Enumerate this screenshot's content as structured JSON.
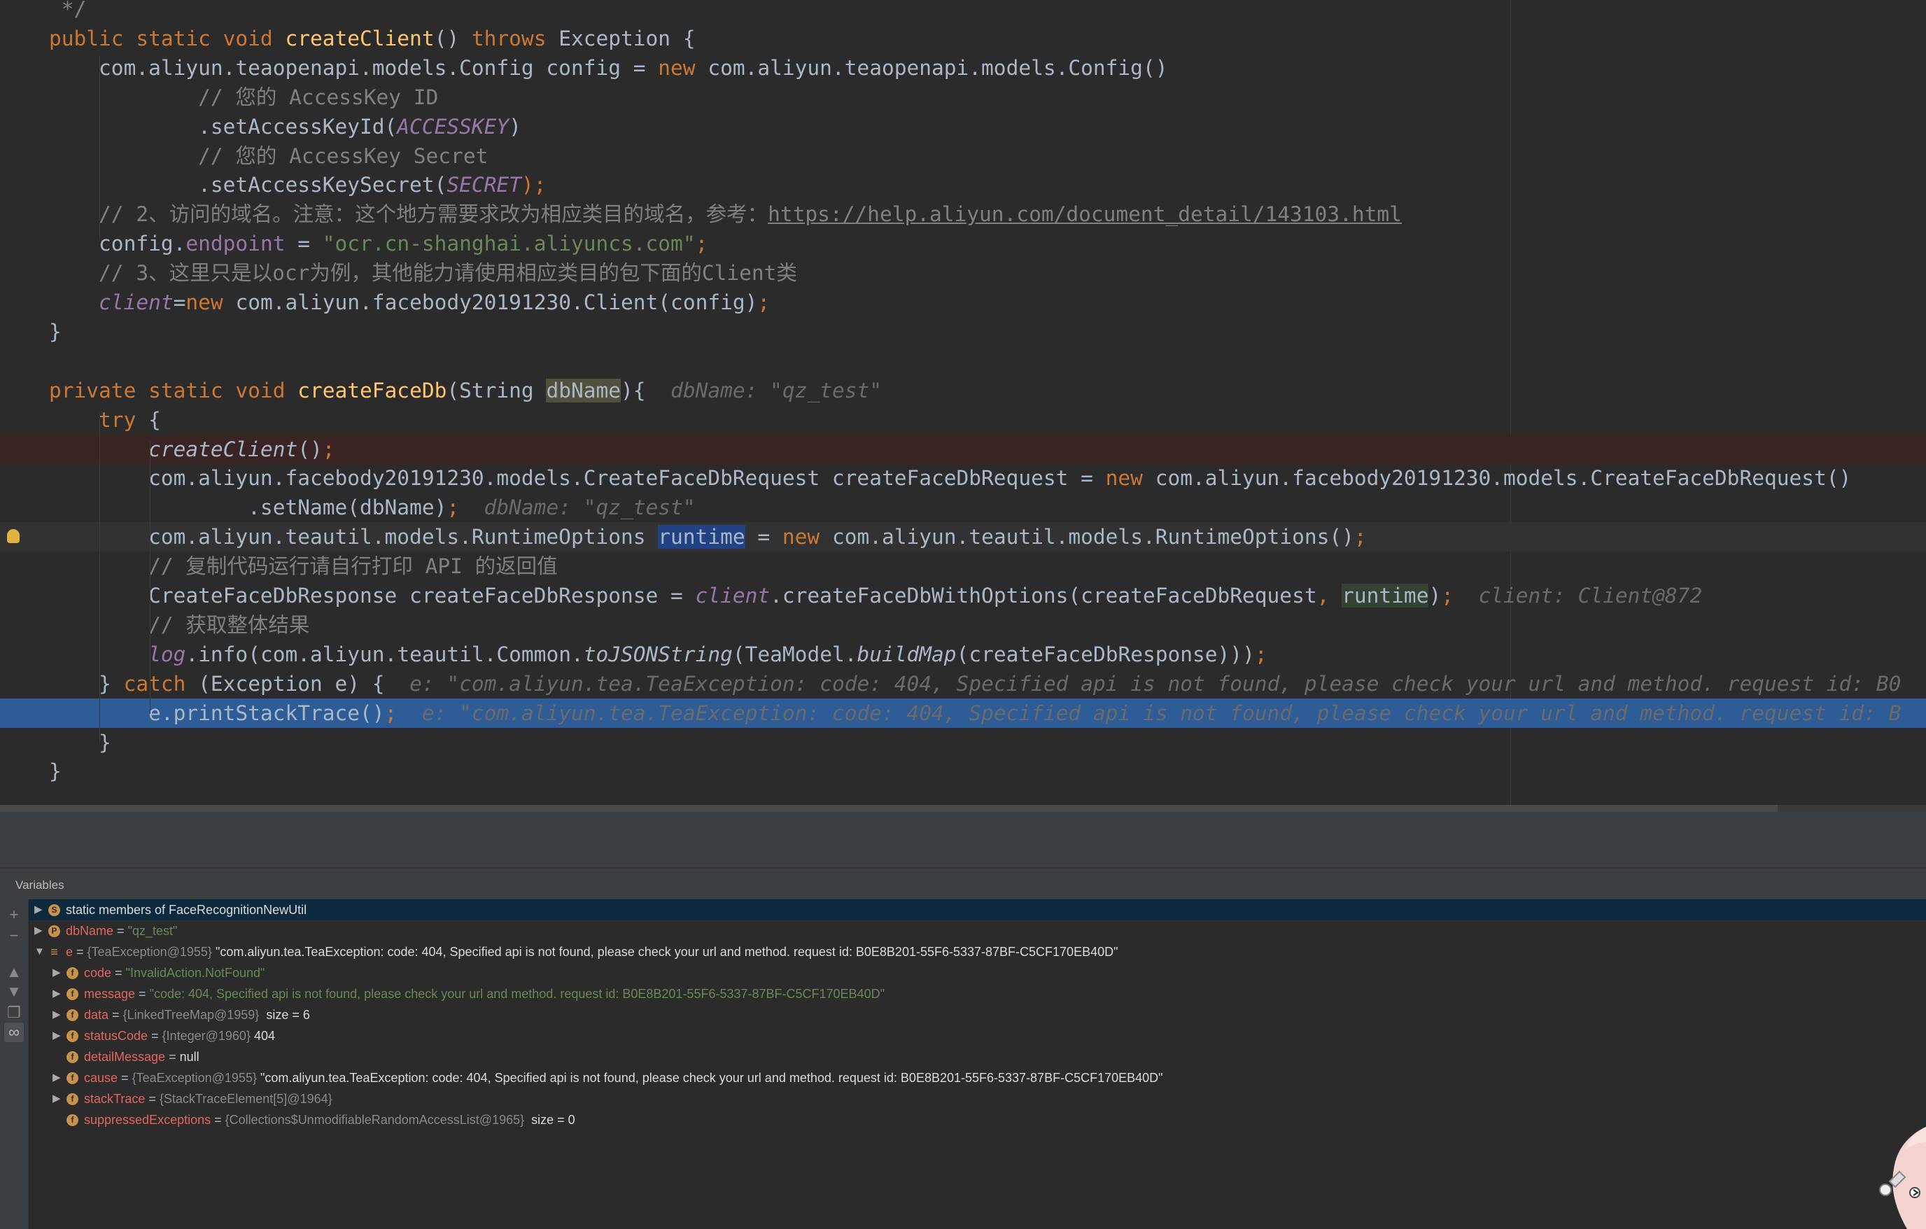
{
  "editor": {
    "lines": [
      [
        {
          "t": " */",
          "c": "cm"
        }
      ],
      [
        {
          "t": "public static void ",
          "c": "kw"
        },
        {
          "t": "createClient",
          "c": "fn"
        },
        {
          "t": "() "
        },
        {
          "t": "throws ",
          "c": "kw"
        },
        {
          "t": "Exception {"
        }
      ],
      [
        {
          "t": "    com.aliyun.teaopenapi.models.Config config = "
        },
        {
          "t": "new ",
          "c": "kw"
        },
        {
          "t": "com.aliyun.teaopenapi.models.Config()"
        }
      ],
      [
        {
          "t": "            // 您的 AccessKey ID",
          "c": "cm"
        }
      ],
      [
        {
          "t": "            .setAccessKeyId("
        },
        {
          "t": "ACCESSKEY",
          "c": "const"
        },
        {
          "t": ")"
        }
      ],
      [
        {
          "t": "            // 您的 AccessKey Secret",
          "c": "cm"
        }
      ],
      [
        {
          "t": "            .setAccessKeySecret("
        },
        {
          "t": "SECRET",
          "c": "const"
        },
        {
          "t": ");",
          "c": "kw"
        }
      ],
      [
        {
          "t": "    // 2、访问的域名。注意：这个地方需要求改为相应类目的域名，参考：",
          "c": "cm"
        },
        {
          "t": "https://help.aliyun.com/document_detail/143103.html",
          "c": "link"
        }
      ],
      [
        {
          "t": "    config."
        },
        {
          "t": "endpoint",
          "c": "fd"
        },
        {
          "t": " = "
        },
        {
          "t": "\"ocr.cn-shanghai.aliyuncs.com\"",
          "c": "st"
        },
        {
          "t": ";",
          "c": "kw"
        }
      ],
      [
        {
          "t": "    // 3、这里只是以ocr为例，其他能力请使用相应类目的包下面的Client类",
          "c": "cm"
        }
      ],
      [
        {
          "t": "    "
        },
        {
          "t": "client",
          "c": "fd it"
        },
        {
          "t": "="
        },
        {
          "t": "new ",
          "c": "kw"
        },
        {
          "t": "com.aliyun.facebody20191230.Client(config)"
        },
        {
          "t": ";",
          "c": "kw"
        }
      ],
      [
        {
          "t": "}"
        }
      ],
      [],
      [
        {
          "t": "private static void ",
          "c": "kw"
        },
        {
          "t": "createFaceDb",
          "c": "fn"
        },
        {
          "t": "(String "
        },
        {
          "t": "dbName",
          "c": "param-hl"
        },
        {
          "t": "){  "
        },
        {
          "t": "dbName: \"qz_test\"",
          "c": "hint"
        }
      ],
      [
        {
          "t": "    "
        },
        {
          "t": "try ",
          "c": "kw"
        },
        {
          "t": "{"
        }
      ],
      [
        {
          "t": "        "
        },
        {
          "t": "createClient",
          "c": "it"
        },
        {
          "t": "()"
        },
        {
          "t": ";",
          "c": "kw"
        }
      ],
      [
        {
          "t": "        com.aliyun.facebody20191230.models.CreateFaceDbRequest createFaceDbRequest = "
        },
        {
          "t": "new ",
          "c": "kw"
        },
        {
          "t": "com.aliyun.facebody20191230.models.CreateFaceDbRequest()"
        }
      ],
      [
        {
          "t": "                .setName(dbName)"
        },
        {
          "t": ";",
          "c": "kw"
        },
        {
          "t": "  "
        },
        {
          "t": "dbName: \"qz_test\"",
          "c": "hint"
        }
      ],
      [
        {
          "t": "        com.aliyun.teautil.models.RuntimeOptions "
        },
        {
          "t": "runtime",
          "c": "sel-hl"
        },
        {
          "t": " = "
        },
        {
          "t": "new ",
          "c": "kw"
        },
        {
          "t": "com.aliyun.teautil.models.RuntimeOptions()"
        },
        {
          "t": ";",
          "c": "kw"
        }
      ],
      [
        {
          "t": "        // 复制代码运行请自行打印 API 的返回值",
          "c": "cm"
        }
      ],
      [
        {
          "t": "        CreateFaceDbResponse createFaceDbResponse = "
        },
        {
          "t": "client",
          "c": "fd it"
        },
        {
          "t": ".createFaceDbWithOptions(createFaceDbRequest"
        },
        {
          "t": ", ",
          "c": "kw"
        },
        {
          "t": "runtime",
          "c": "rt-hl"
        },
        {
          "t": ")"
        },
        {
          "t": ";",
          "c": "kw"
        },
        {
          "t": "  "
        },
        {
          "t": "client: Client@872",
          "c": "hint"
        }
      ],
      [
        {
          "t": "        // 获取整体结果",
          "c": "cm"
        }
      ],
      [
        {
          "t": "        "
        },
        {
          "t": "log",
          "c": "fd it"
        },
        {
          "t": ".info(com.aliyun.teautil.Common."
        },
        {
          "t": "toJSONString",
          "c": "it"
        },
        {
          "t": "(TeaModel."
        },
        {
          "t": "buildMap",
          "c": "it"
        },
        {
          "t": "(createFaceDbResponse)))"
        },
        {
          "t": ";",
          "c": "kw"
        }
      ],
      [
        {
          "t": "    } "
        },
        {
          "t": "catch ",
          "c": "kw"
        },
        {
          "t": "(Exception e) {  "
        },
        {
          "t": "e: \"com.aliyun.tea.TeaException: code: 404, Specified api is not found, please check your url and method. request id: B0",
          "c": "hint"
        }
      ],
      [
        {
          "t": "        e.printStackTrace()"
        },
        {
          "t": ";",
          "c": "kw"
        },
        {
          "t": "  "
        },
        {
          "t": "e: \"com.aliyun.tea.TeaException: code: 404, Specified api is not found, please check your url and method. request id: B",
          "c": "hint"
        }
      ],
      [
        {
          "t": "    }"
        }
      ],
      [
        {
          "t": "}"
        }
      ]
    ]
  },
  "variables_panel": {
    "title": "Variables",
    "toolbar": [
      {
        "icon": "add-icon",
        "glyph": "+"
      },
      {
        "icon": "remove-icon",
        "glyph": "−"
      },
      {
        "icon": "up-icon",
        "glyph": "▲"
      },
      {
        "icon": "down-icon",
        "glyph": "▼"
      },
      {
        "icon": "copy-icon",
        "glyph": "❐"
      },
      {
        "icon": "watches-icon",
        "glyph": "∞"
      }
    ],
    "rows": [
      {
        "toggle": "▶",
        "icon": "S",
        "parts": [
          {
            "t": "static members of FaceRecognitionNewUtil",
            "c": "vv"
          }
        ]
      },
      {
        "toggle": "▶",
        "icon": "P",
        "parts": [
          {
            "t": "dbName",
            "c": "nm"
          },
          {
            "t": " = ",
            "c": "eq"
          },
          {
            "t": "\"qz_test\"",
            "c": "sv"
          }
        ]
      },
      {
        "toggle": "▼",
        "icon": "≡",
        "parts": [
          {
            "t": "e",
            "c": "nm"
          },
          {
            "t": " = ",
            "c": "eq"
          },
          {
            "t": "{TeaException@1955} ",
            "c": "tp"
          },
          {
            "t": "\"com.aliyun.tea.TeaException: code: 404, Specified api is not found, please check your url and method. request id: B0E8B201-55F6-5337-87BF-C5CF170EB40D\"",
            "c": "vv"
          }
        ]
      },
      {
        "toggle": "▶",
        "icon": "f",
        "parts": [
          {
            "t": "code",
            "c": "nm"
          },
          {
            "t": " = ",
            "c": "eq"
          },
          {
            "t": "\"InvalidAction.NotFound\"",
            "c": "sv"
          }
        ]
      },
      {
        "toggle": "▶",
        "icon": "f",
        "parts": [
          {
            "t": "message",
            "c": "nm"
          },
          {
            "t": " = ",
            "c": "eq"
          },
          {
            "t": "\"code: 404, Specified api is not found, please check your url and method. request id: B0E8B201-55F6-5337-87BF-C5CF170EB40D\"",
            "c": "sv"
          }
        ]
      },
      {
        "toggle": "▶",
        "icon": "f",
        "parts": [
          {
            "t": "data",
            "c": "nm"
          },
          {
            "t": " = ",
            "c": "eq"
          },
          {
            "t": "{LinkedTreeMap@1959} ",
            "c": "tp"
          },
          {
            "t": " size = 6",
            "c": "vv"
          }
        ]
      },
      {
        "toggle": "▶",
        "icon": "f",
        "parts": [
          {
            "t": "statusCode",
            "c": "nm"
          },
          {
            "t": " = ",
            "c": "eq"
          },
          {
            "t": "{Integer@1960} ",
            "c": "tp"
          },
          {
            "t": "404",
            "c": "vv"
          }
        ]
      },
      {
        "toggle": "",
        "icon": "f",
        "parts": [
          {
            "t": "detailMessage",
            "c": "nm"
          },
          {
            "t": " = ",
            "c": "eq"
          },
          {
            "t": "null",
            "c": "vv"
          }
        ]
      },
      {
        "toggle": "▶",
        "icon": "f",
        "parts": [
          {
            "t": "cause",
            "c": "nm"
          },
          {
            "t": " = ",
            "c": "eq"
          },
          {
            "t": "{TeaException@1955} ",
            "c": "tp"
          },
          {
            "t": "\"com.aliyun.tea.TeaException: code: 404, Specified api is not found, please check your url and method. request id: B0E8B201-55F6-5337-87BF-C5CF170EB40D\"",
            "c": "vv"
          }
        ]
      },
      {
        "toggle": "▶",
        "icon": "f",
        "parts": [
          {
            "t": "stackTrace",
            "c": "nm"
          },
          {
            "t": " = ",
            "c": "eq"
          },
          {
            "t": "{StackTraceElement[5]@1964}",
            "c": "tp"
          }
        ]
      },
      {
        "toggle": "",
        "icon": "f",
        "parts": [
          {
            "t": "suppressedExceptions",
            "c": "nm"
          },
          {
            "t": " = ",
            "c": "eq"
          },
          {
            "t": "{Collections$UnmodifiableRandomAccessList@1965} ",
            "c": "tp"
          },
          {
            "t": " size = 0",
            "c": "vv"
          }
        ]
      }
    ]
  }
}
